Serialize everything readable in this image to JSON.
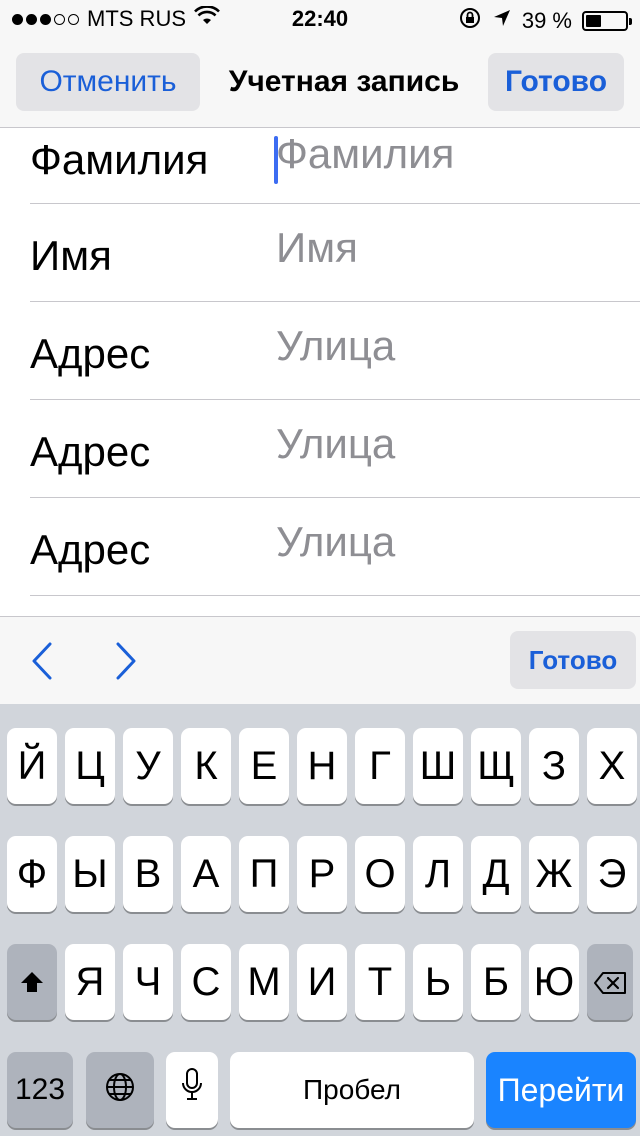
{
  "status_bar": {
    "carrier": "MTS RUS",
    "time": "22:40",
    "battery_percent": "39 %",
    "battery_level": 0.39,
    "signal_bars_filled": 3,
    "signal_bars_total": 5
  },
  "nav": {
    "cancel_label": "Отменить",
    "title": "Учетная запись",
    "done_label": "Готово"
  },
  "form": {
    "rows": [
      {
        "label": "Фамилия",
        "placeholder": "Фамилия"
      },
      {
        "label": "Имя",
        "placeholder": "Имя"
      },
      {
        "label": "Адрес",
        "placeholder": "Улица"
      },
      {
        "label": "Адрес",
        "placeholder": "Улица"
      },
      {
        "label": "Адрес",
        "placeholder": "Улица"
      }
    ]
  },
  "accessory": {
    "done_label": "Готово",
    "prev_icon": "chevron-left-icon",
    "next_icon": "chevron-right-icon"
  },
  "keyboard": {
    "row1": [
      "Й",
      "Ц",
      "У",
      "К",
      "Е",
      "Н",
      "Г",
      "Ш",
      "Щ",
      "З",
      "Х"
    ],
    "row2": [
      "Ф",
      "Ы",
      "В",
      "А",
      "П",
      "Р",
      "О",
      "Л",
      "Д",
      "Ж",
      "Э"
    ],
    "row3": [
      "Я",
      "Ч",
      "С",
      "М",
      "И",
      "Т",
      "Ь",
      "Б",
      "Ю"
    ],
    "numbers_label": "123",
    "space_label": "Пробел",
    "go_label": "Перейти"
  },
  "colors": {
    "accent": "#1a5fd8",
    "go_key": "#1a84ff",
    "cursor": "#3c6cf2",
    "keyboard_bg": "#d1d5db"
  }
}
